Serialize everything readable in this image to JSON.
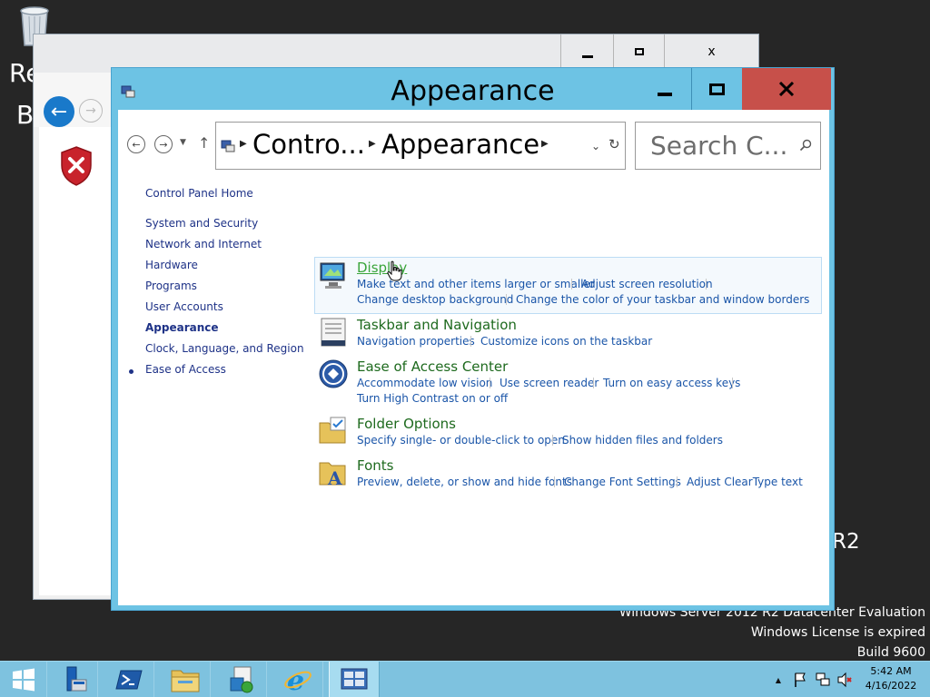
{
  "desktop": {
    "recycle_label_line1": "Re",
    "recycle_label_line2": "B",
    "r2_fragment": "R2",
    "watermark": {
      "line1": "Windows Server 2012 R2 Datacenter Evaluation",
      "line2": "Windows License is expired",
      "line3": "Build 9600"
    }
  },
  "background_window": {
    "min_label": "–",
    "max_label": "☐",
    "close_label": "x"
  },
  "window": {
    "title": "Appearance",
    "address": {
      "segment1": "Contro...",
      "segment2": "Appearance"
    },
    "search": {
      "placeholder": "Search C..."
    }
  },
  "left_nav": {
    "home": "Control Panel Home",
    "items": [
      "System and Security",
      "Network and Internet",
      "Hardware",
      "Programs",
      "User Accounts",
      "Appearance",
      "Clock, Language, and Region",
      "Ease of Access"
    ],
    "active_item": "Appearance"
  },
  "categories": [
    {
      "title": "Display",
      "links": [
        "Make text and other items larger or smaller",
        "Adjust screen resolution",
        "Change desktop background",
        "Change the color of your taskbar and window borders"
      ]
    },
    {
      "title": "Taskbar and Navigation",
      "links": [
        "Navigation properties",
        "Customize icons on the taskbar"
      ]
    },
    {
      "title": "Ease of Access Center",
      "links": [
        "Accommodate low vision",
        "Use screen reader",
        "Turn on easy access keys",
        "Turn High Contrast on or off"
      ]
    },
    {
      "title": "Folder Options",
      "links": [
        "Specify single- or double-click to open",
        "Show hidden files and folders"
      ]
    },
    {
      "title": "Fonts",
      "links": [
        "Preview, delete, or show and hide fonts",
        "Change Font Settings",
        "Adjust ClearType text"
      ]
    }
  ],
  "taskbar": {
    "apps": [
      "start-icon",
      "server-manager-icon",
      "powershell-icon",
      "file-explorer-icon",
      "setup-icon",
      "internet-explorer-icon",
      "control-panel-icon"
    ],
    "clock": {
      "time": "5:42 AM",
      "date": "4/16/2022"
    }
  },
  "colors": {
    "window_frame": "#6dc3e4",
    "close_button": "#c7504a",
    "taskbar": "#7ec2df",
    "link": "#1a55a8",
    "category_title": "#1e6a1e",
    "desktop": "#262626"
  }
}
